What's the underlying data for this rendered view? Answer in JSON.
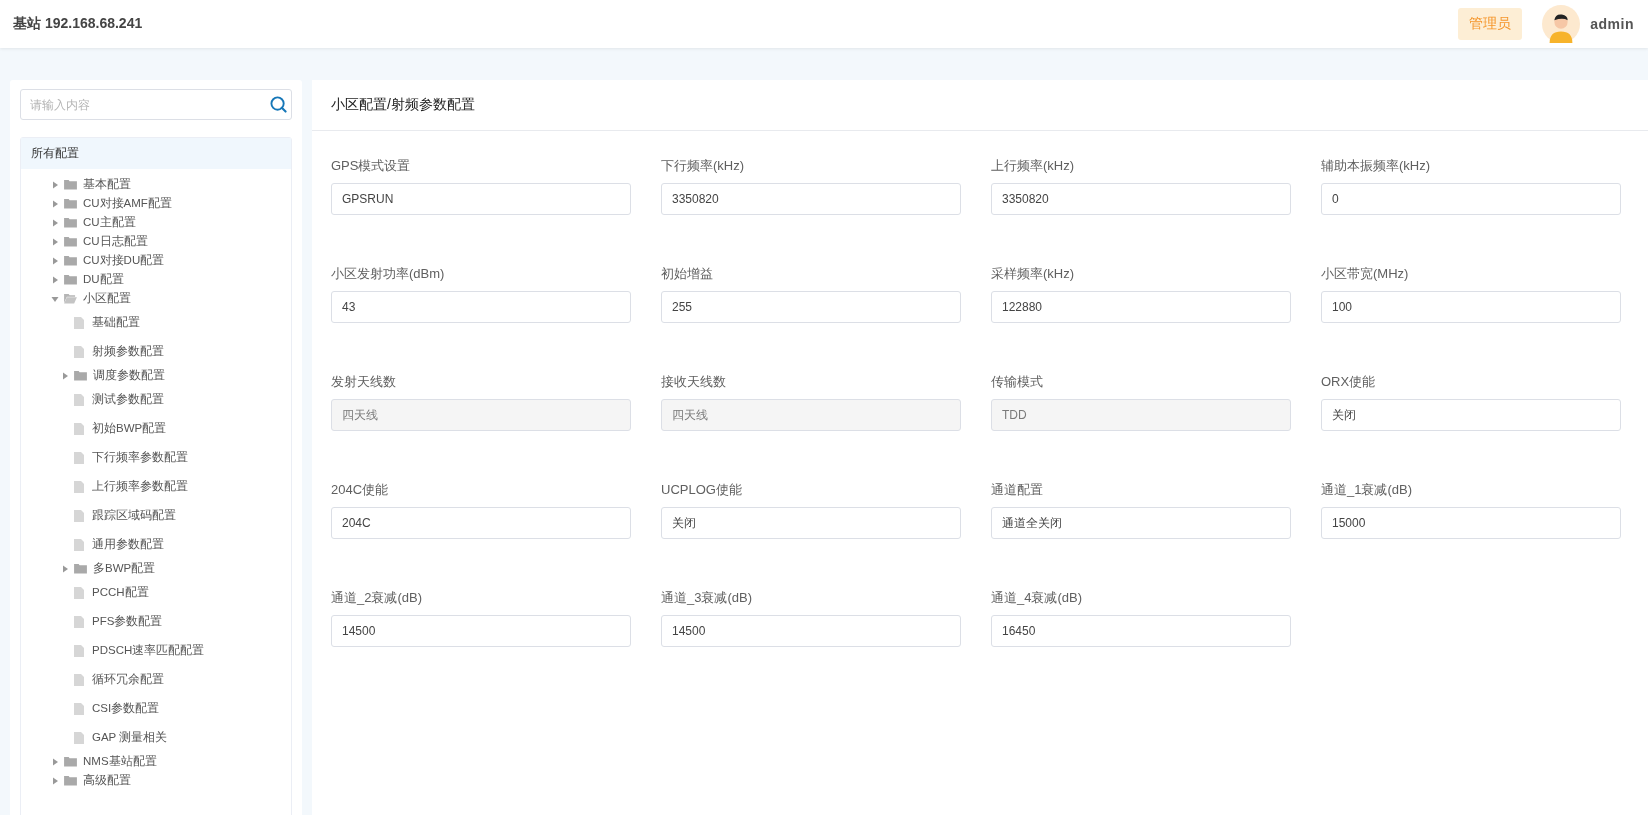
{
  "header": {
    "title": "基站 192.168.68.241",
    "role_badge": "管理员",
    "username": "admin"
  },
  "sidebar": {
    "search": {
      "placeholder": "请输入内容"
    },
    "tree": {
      "label": "所有配置",
      "children": [
        {
          "label": "基本配置",
          "kind": "folder",
          "expanded": false
        },
        {
          "label": "CU对接AMF配置",
          "kind": "folder",
          "expanded": false
        },
        {
          "label": "CU主配置",
          "kind": "folder",
          "expanded": false
        },
        {
          "label": "CU日志配置",
          "kind": "folder",
          "expanded": false
        },
        {
          "label": "CU对接DU配置",
          "kind": "folder",
          "expanded": false
        },
        {
          "label": "DU配置",
          "kind": "folder",
          "expanded": false
        },
        {
          "label": "小区配置",
          "kind": "folder",
          "expanded": true,
          "children": [
            {
              "label": "基础配置",
              "kind": "file"
            },
            {
              "label": "射频参数配置",
              "kind": "file"
            },
            {
              "label": "调度参数配置",
              "kind": "folder",
              "expanded": false
            },
            {
              "label": "测试参数配置",
              "kind": "file"
            },
            {
              "label": "初始BWP配置",
              "kind": "file"
            },
            {
              "label": "下行频率参数配置",
              "kind": "file"
            },
            {
              "label": "上行频率参数配置",
              "kind": "file"
            },
            {
              "label": "跟踪区域码配置",
              "kind": "file"
            },
            {
              "label": "通用参数配置",
              "kind": "file"
            },
            {
              "label": "多BWP配置",
              "kind": "folder",
              "expanded": false
            },
            {
              "label": "PCCH配置",
              "kind": "file"
            },
            {
              "label": "PFS参数配置",
              "kind": "file"
            },
            {
              "label": "PDSCH速率匹配配置",
              "kind": "file"
            },
            {
              "label": "循环冗余配置",
              "kind": "file"
            },
            {
              "label": "CSI参数配置",
              "kind": "file"
            },
            {
              "label": "GAP 测量相关",
              "kind": "file"
            }
          ]
        },
        {
          "label": "NMS基站配置",
          "kind": "folder",
          "expanded": false
        },
        {
          "label": "高级配置",
          "kind": "folder",
          "expanded": false
        }
      ]
    }
  },
  "panel": {
    "title": "小区配置/射频参数配置",
    "fields": [
      {
        "label": "GPS模式设置",
        "value": "GPSRUN",
        "disabled": false
      },
      {
        "label": "下行频率(kHz)",
        "value": "3350820",
        "disabled": false
      },
      {
        "label": "上行频率(kHz)",
        "value": "3350820",
        "disabled": false
      },
      {
        "label": "辅助本振频率(kHz)",
        "value": "0",
        "disabled": false
      },
      {
        "label": "小区发射功率(dBm)",
        "value": "43",
        "disabled": false
      },
      {
        "label": "初始增益",
        "value": "255",
        "disabled": false
      },
      {
        "label": "采样频率(kHz)",
        "value": "122880",
        "disabled": false
      },
      {
        "label": "小区带宽(MHz)",
        "value": "100",
        "disabled": false
      },
      {
        "label": "发射天线数",
        "value": "四天线",
        "disabled": true
      },
      {
        "label": "接收天线数",
        "value": "四天线",
        "disabled": true
      },
      {
        "label": "传输模式",
        "value": "TDD",
        "disabled": true
      },
      {
        "label": "ORX使能",
        "value": "关闭",
        "disabled": false
      },
      {
        "label": "204C使能",
        "value": "204C",
        "disabled": false
      },
      {
        "label": "UCPLOG使能",
        "value": "关闭",
        "disabled": false
      },
      {
        "label": "通道配置",
        "value": "通道全关闭",
        "disabled": false
      },
      {
        "label": "通道_1衰减(dB)",
        "value": "15000",
        "disabled": false
      },
      {
        "label": "通道_2衰减(dB)",
        "value": "14500",
        "disabled": false
      },
      {
        "label": "通道_3衰减(dB)",
        "value": "14500",
        "disabled": false
      },
      {
        "label": "通道_4衰减(dB)",
        "value": "16450",
        "disabled": false
      }
    ]
  }
}
